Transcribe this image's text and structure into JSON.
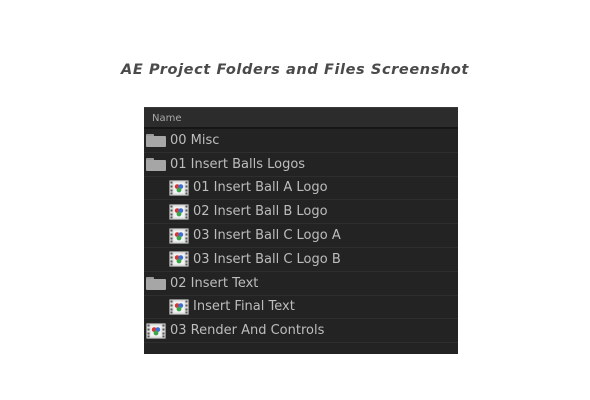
{
  "caption": "AE Project Folders and Files Screenshot",
  "panel": {
    "column_header": "Name",
    "items": [
      {
        "label": "00 Misc",
        "type": "folder",
        "icon": "folder-icon"
      },
      {
        "label": "01 Insert Balls Logos",
        "type": "folder",
        "icon": "folder-icon"
      },
      {
        "label": "01 Insert Ball A Logo",
        "type": "composition",
        "icon": "composition-icon"
      },
      {
        "label": "02 Insert Ball B Logo",
        "type": "composition",
        "icon": "composition-icon"
      },
      {
        "label": "03 Insert Ball C Logo A",
        "type": "composition",
        "icon": "composition-icon"
      },
      {
        "label": "03 Insert Ball C Logo B",
        "type": "composition",
        "icon": "composition-icon"
      },
      {
        "label": "02 Insert Text",
        "type": "folder",
        "icon": "folder-icon"
      },
      {
        "label": "Insert Final Text",
        "type": "composition",
        "icon": "composition-icon"
      },
      {
        "label": "03 Render And Controls",
        "type": "composition",
        "icon": "composition-icon"
      }
    ]
  }
}
